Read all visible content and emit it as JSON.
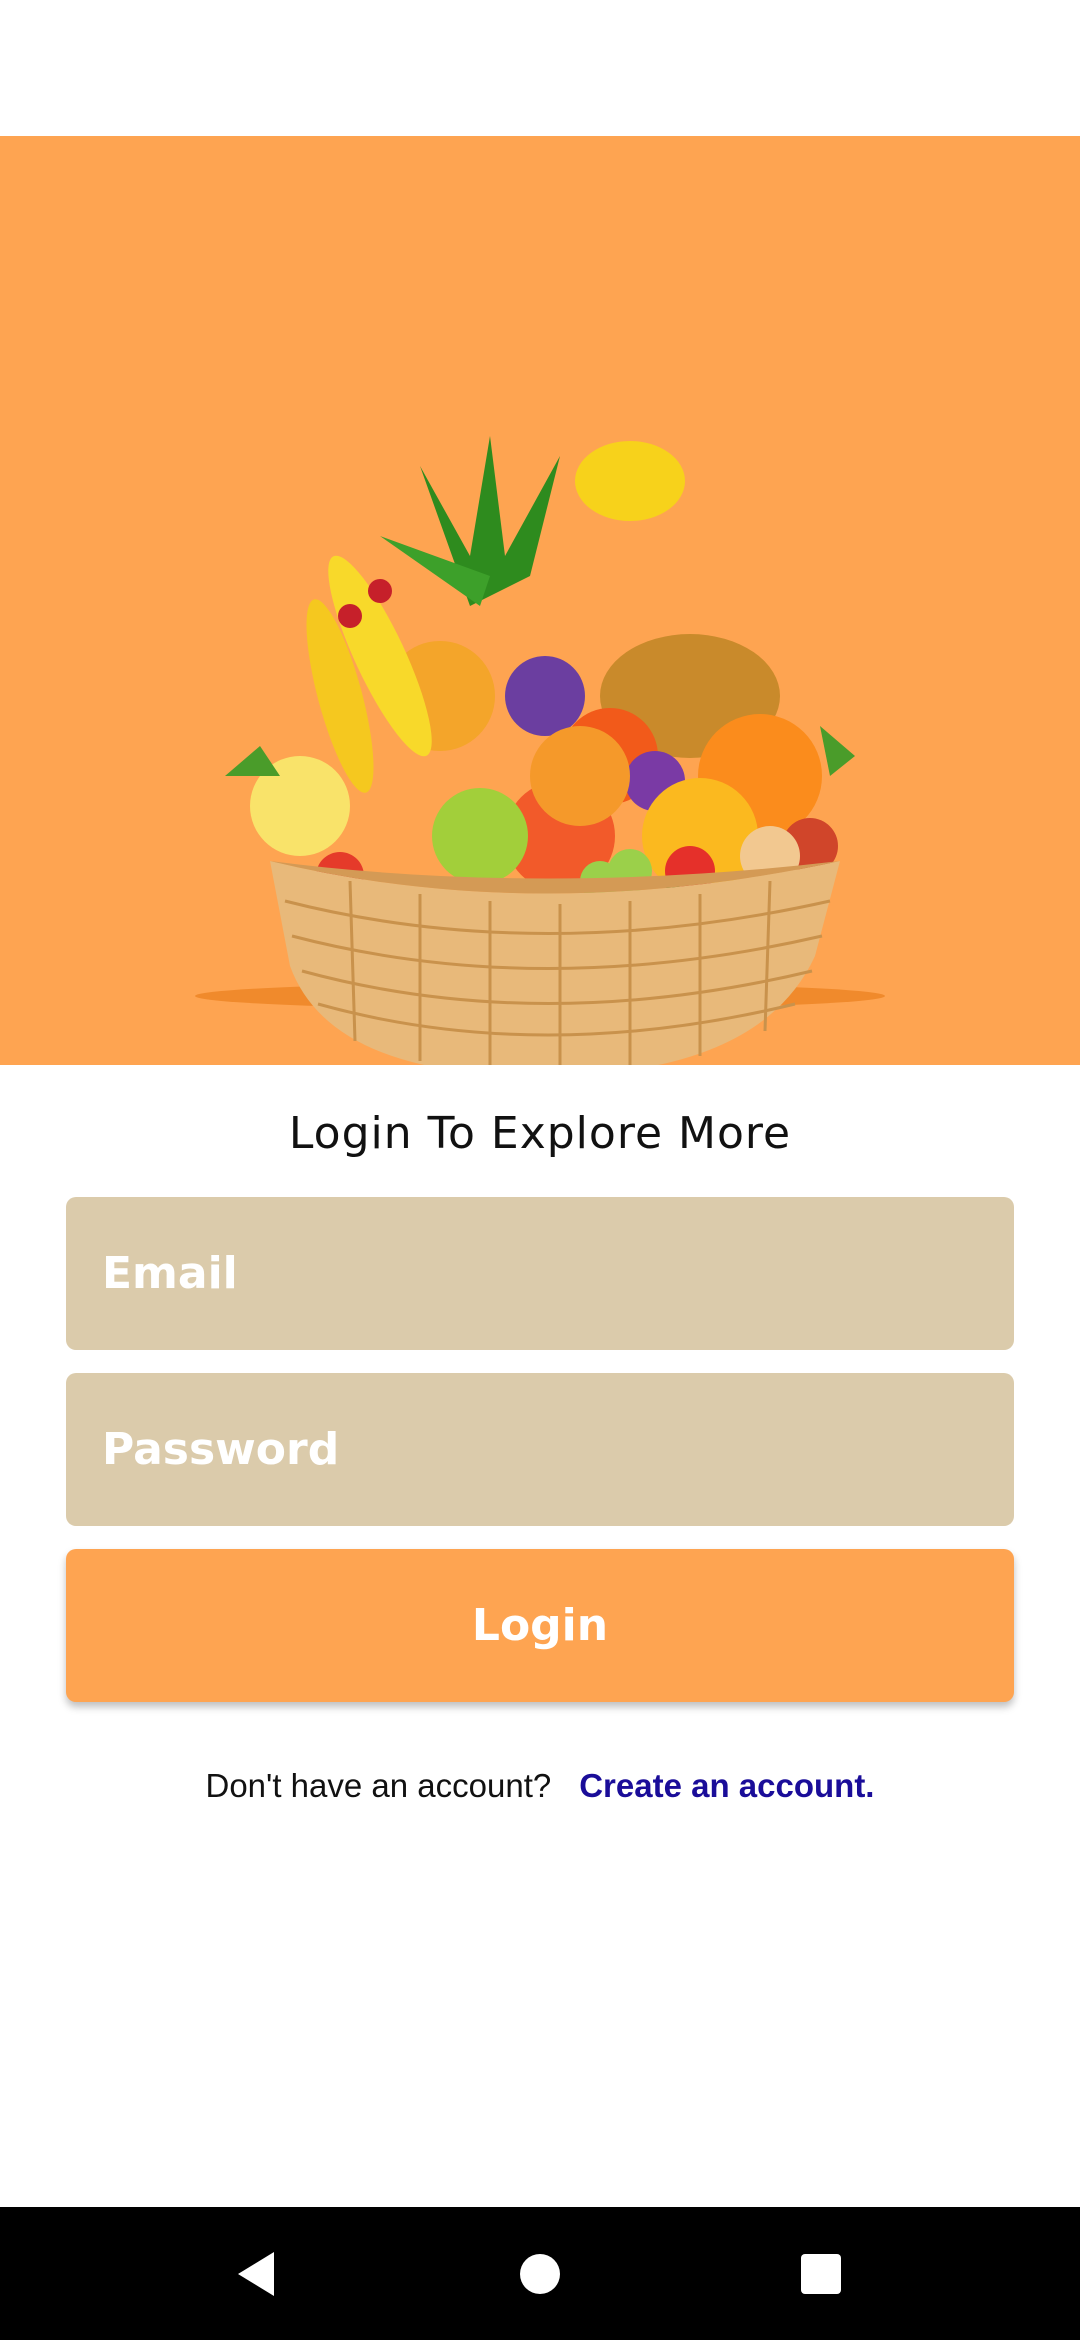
{
  "login": {
    "title": "Login To Explore More",
    "email_placeholder": "Email",
    "password_placeholder": "Password",
    "login_label": "Login",
    "signup_prompt": "Don't have an account?",
    "signup_link": "Create an account."
  },
  "navigation": {
    "back_icon": "back-triangle-icon",
    "home_icon": "home-circle-icon",
    "recents_icon": "recents-square-icon"
  },
  "colors": {
    "accent": "#fea451",
    "field_background": "#dbcbab",
    "link": "#1a0d99",
    "nav_bar": "#000000"
  }
}
